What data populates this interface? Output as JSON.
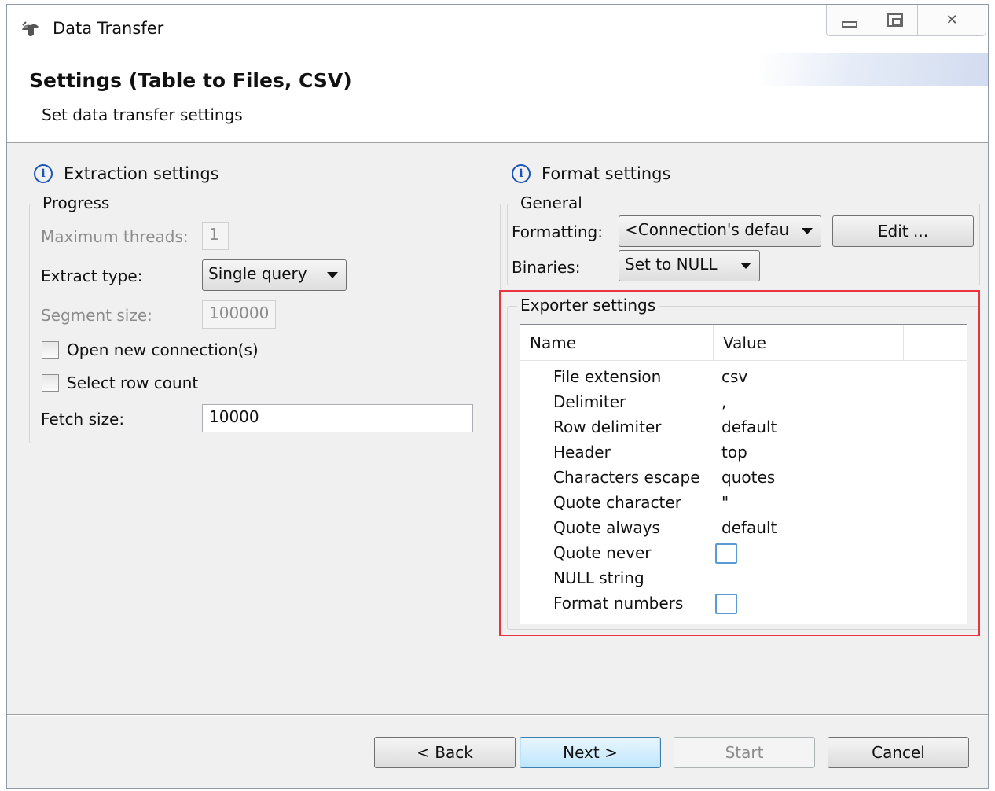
{
  "window": {
    "title": "Data Transfer"
  },
  "header": {
    "title": "Settings (Table to Files, CSV)",
    "description": "Set data transfer settings"
  },
  "extraction": {
    "heading": "Extraction settings",
    "progress_label": "Progress",
    "max_threads_label": "Maximum threads:",
    "max_threads_value": "1",
    "extract_type_label": "Extract type:",
    "extract_type_value": "Single query",
    "segment_size_label": "Segment size:",
    "segment_size_value": "100000",
    "open_new_connections_label": "Open new connection(s)",
    "select_row_count_label": "Select row count",
    "fetch_size_label": "Fetch size:",
    "fetch_size_value": "10000"
  },
  "format": {
    "heading": "Format settings",
    "general_label": "General",
    "formatting_label": "Formatting:",
    "formatting_value": "<Connection's defau",
    "edit_button": "Edit ...",
    "binaries_label": "Binaries:",
    "binaries_value": "Set to NULL"
  },
  "exporter": {
    "label": "Exporter settings",
    "columns": [
      "Name",
      "Value"
    ],
    "rows": [
      {
        "name": "File extension",
        "value": "csv"
      },
      {
        "name": "Delimiter",
        "value": ","
      },
      {
        "name": "Row delimiter",
        "value": "default"
      },
      {
        "name": "Header",
        "value": "top"
      },
      {
        "name": "Characters escape",
        "value": "quotes"
      },
      {
        "name": "Quote character",
        "value": "\""
      },
      {
        "name": "Quote always",
        "value": "default"
      },
      {
        "name": "Quote never",
        "value": "",
        "checkbox": true
      },
      {
        "name": "NULL string",
        "value": ""
      },
      {
        "name": "Format numbers",
        "value": "",
        "checkbox": true
      }
    ]
  },
  "buttons": {
    "back": "< Back",
    "next": "Next >",
    "start": "Start",
    "cancel": "Cancel"
  },
  "colors": {
    "highlight": "#e8343f",
    "info_icon": "#1a55b5",
    "checkbox_border": "#5a9bd5"
  },
  "icons": {
    "app": "app-icon",
    "info": "info-icon"
  }
}
